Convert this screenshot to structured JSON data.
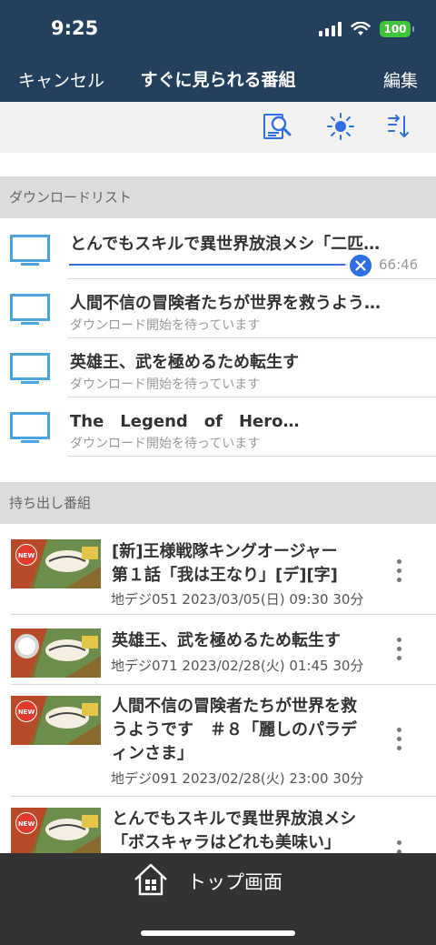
{
  "status": {
    "time": "9:25",
    "battery": "100"
  },
  "nav": {
    "cancel": "キャンセル",
    "title": "すぐに見られる番組",
    "edit": "編集"
  },
  "toolbar": {
    "icons": [
      "search-document-icon",
      "brightness-icon",
      "sort-icon"
    ]
  },
  "download_section": {
    "header": "ダウンロードリスト",
    "items": [
      {
        "title": "とんでもスキルで異世界放浪メシ「二匹…",
        "progress": 0.99,
        "remaining": "66:46"
      },
      {
        "title": "人間不信の冒険者たちが世界を救うよう…",
        "status": "ダウンロード開始を待っています"
      },
      {
        "title": "英雄王、武を極めるため転生す",
        "status": "ダウンロード開始を待っています"
      },
      {
        "title": "The　Legend　of　Hero…",
        "status": "ダウンロード開始を待っています"
      }
    ]
  },
  "takeout_section": {
    "header": "持ち出し番組",
    "items": [
      {
        "badge": "NEW",
        "title_lines": [
          "[新]王様戦隊キングオージャー",
          "第１話「我は王なり」[デ][字]"
        ],
        "meta": "地デジ051  2023/03/05(日) 09:30  30分"
      },
      {
        "badge": "",
        "title_lines": [
          "英雄王、武を極めるため転生す"
        ],
        "meta": "地デジ071  2023/02/28(火) 01:45  30分"
      },
      {
        "badge": "NEW",
        "title_lines": [
          "人間不信の冒険者たちが世界を救",
          "うようです　＃８「麗しのパラデ",
          "ィンさま」"
        ],
        "meta": "地デジ091  2023/02/28(火) 23:00  30分"
      },
      {
        "badge": "NEW",
        "title_lines": [
          "とんでもスキルで異世界放浪メシ",
          "「ボスキャラはどれも美味い」"
        ],
        "meta": ""
      }
    ]
  },
  "tabbar": {
    "home_label": "トップ画面"
  },
  "colors": {
    "header_bg": "#24405c",
    "accent_blue": "#2f6fe6",
    "tv_icon": "#4aa3dc",
    "new_badge": "#e23a2e",
    "tabbar_bg": "#333333"
  }
}
